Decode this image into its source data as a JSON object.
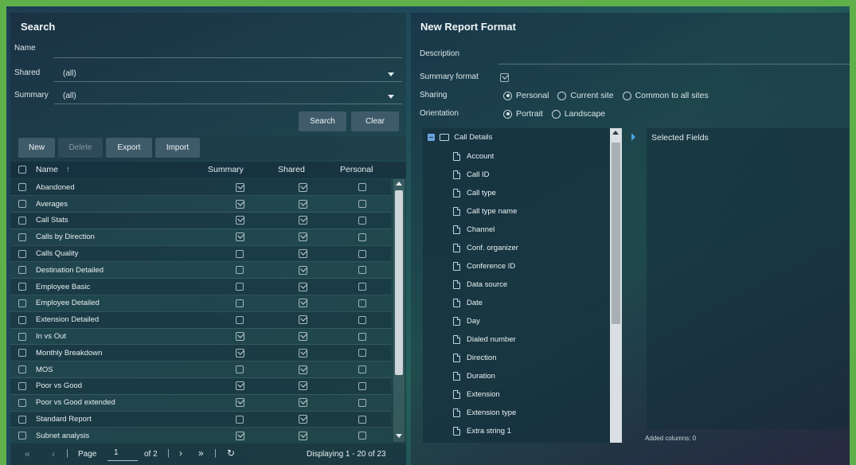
{
  "search": {
    "title": "Search",
    "name_label": "Name",
    "shared_label": "Shared",
    "shared_value": "(all)",
    "summary_label": "Summary",
    "summary_value": "(all)",
    "search_button": "Search",
    "clear_button": "Clear"
  },
  "toolbar": {
    "new": "New",
    "delete": "Delete",
    "export": "Export",
    "import": "Import"
  },
  "table": {
    "headers": {
      "name": "Name",
      "sort_glyph": "↑",
      "summary": "Summary",
      "shared": "Shared",
      "personal": "Personal"
    },
    "rows": [
      {
        "name": "Abandoned",
        "summary": true,
        "shared": true,
        "personal": false
      },
      {
        "name": "Averages",
        "summary": true,
        "shared": true,
        "personal": false
      },
      {
        "name": "Call Stats",
        "summary": true,
        "shared": true,
        "personal": false
      },
      {
        "name": "Calls by Direction",
        "summary": true,
        "shared": true,
        "personal": false
      },
      {
        "name": "Calls Quality",
        "summary": false,
        "shared": true,
        "personal": false
      },
      {
        "name": "Destination Detailed",
        "summary": false,
        "shared": true,
        "personal": false
      },
      {
        "name": "Employee Basic",
        "summary": false,
        "shared": true,
        "personal": false
      },
      {
        "name": "Employee Detailed",
        "summary": false,
        "shared": true,
        "personal": false
      },
      {
        "name": "Extension Detailed",
        "summary": false,
        "shared": true,
        "personal": false
      },
      {
        "name": "In vs Out",
        "summary": true,
        "shared": true,
        "personal": false
      },
      {
        "name": "Monthly Breakdown",
        "summary": true,
        "shared": true,
        "personal": false
      },
      {
        "name": "MOS",
        "summary": false,
        "shared": true,
        "personal": false
      },
      {
        "name": "Poor vs Good",
        "summary": true,
        "shared": true,
        "personal": false
      },
      {
        "name": "Poor vs Good extended",
        "summary": true,
        "shared": true,
        "personal": false
      },
      {
        "name": "Standard Report",
        "summary": false,
        "shared": true,
        "personal": false
      },
      {
        "name": "Subnet analysis",
        "summary": true,
        "shared": true,
        "personal": false
      }
    ]
  },
  "pager": {
    "page_label": "Page",
    "page_value": "1",
    "of_label": "of 2",
    "displaying": "Displaying 1 - 20 of 23"
  },
  "report": {
    "title": "New Report Format",
    "description_label": "Description",
    "summary_format_label": "Summary format",
    "sharing_label": "Sharing",
    "sharing_options": [
      "Personal",
      "Current site",
      "Common to all sites"
    ],
    "orientation_label": "Orientation",
    "orientation_options": [
      "Portrait",
      "Landscape"
    ],
    "tree_root": "Call Details",
    "tree_items": [
      "Account",
      "Call ID",
      "Call type",
      "Call type name",
      "Channel",
      "Conf. organizer",
      "Conference ID",
      "Data source",
      "Date",
      "Day",
      "Dialed number",
      "Direction",
      "Duration",
      "Extension",
      "Extension type",
      "Extra string 1"
    ],
    "selected_fields_title": "Selected Fields",
    "added_columns": "Added columns: 0"
  },
  "colors": {
    "frame_green": "#5fb04a",
    "button_bg": "#3f5b6a"
  }
}
